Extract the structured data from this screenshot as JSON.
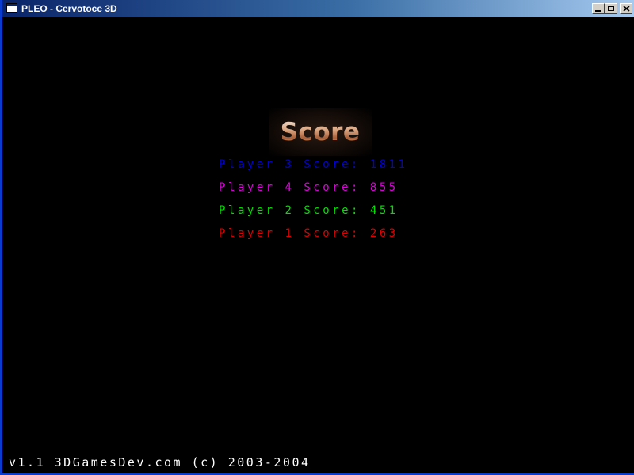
{
  "window": {
    "title": "PLEO - Cervotoce 3D"
  },
  "logo": {
    "text": "Score"
  },
  "scores": [
    {
      "player": "Player 3",
      "label": "Score:",
      "score": "1811",
      "color": "#0000e0"
    },
    {
      "player": "Player 4",
      "label": "Score:",
      "score": "855",
      "color": "#e000e0"
    },
    {
      "player": "Player 2",
      "label": "Score:",
      "score": "451",
      "color": "#00e000"
    },
    {
      "player": "Player 1",
      "label": "Score:",
      "score": "263",
      "color": "#e00000"
    }
  ],
  "footer": {
    "text": "v1.1  3DGamesDev.com (c) 2003-2004"
  },
  "icons": {
    "app": "window-icon",
    "minimize": "minimize-icon",
    "maximize": "maximize-icon",
    "close": "close-icon"
  }
}
